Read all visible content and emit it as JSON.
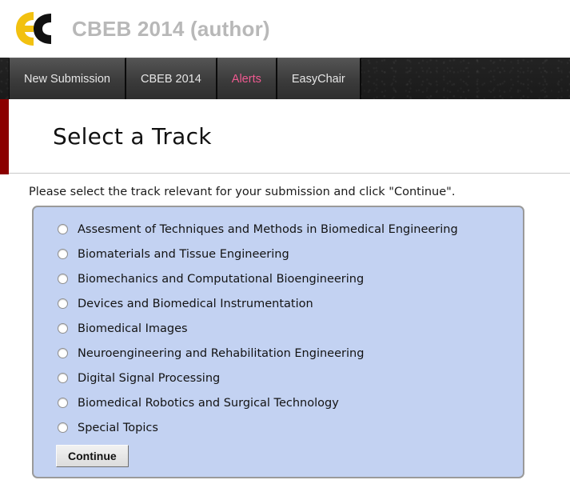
{
  "header": {
    "logo_icon": "easychair-ec-logo",
    "logo_colors": {
      "e": "#F2C110",
      "c": "#111111"
    },
    "title": "CBEB 2014 (author)",
    "title_color": "#b8b8b8"
  },
  "navbar": {
    "background_color": "#1e1e1e",
    "tabs": [
      {
        "label": "New Submission",
        "color": "#e6e6e6",
        "active": false
      },
      {
        "label": "CBEB 2014",
        "color": "#e6e6e6",
        "active": false
      },
      {
        "label": "Alerts",
        "color": "#f05a91",
        "active": false
      },
      {
        "label": "EasyChair",
        "color": "#e6e6e6",
        "active": false
      }
    ]
  },
  "page": {
    "accent_bar_color": "#8b0000",
    "title": "Select a Track",
    "instructions": "Please select the track relevant for your submission and click \"Continue\"."
  },
  "track_panel": {
    "background_color": "#c3d2f2",
    "border_color": "#9a9a9a",
    "selected": null,
    "tracks": [
      {
        "label": "Assesment of Techniques and Methods in Biomedical Engineering",
        "checked": false
      },
      {
        "label": "Biomaterials and Tissue Engineering",
        "checked": false
      },
      {
        "label": "Biomechanics and Computational Bioengineering",
        "checked": false
      },
      {
        "label": "Devices and Biomedical Instrumentation",
        "checked": false
      },
      {
        "label": "Biomedical Images",
        "checked": false
      },
      {
        "label": "Neuroengineering and Rehabilitation Engineering",
        "checked": false
      },
      {
        "label": "Digital Signal Processing",
        "checked": false
      },
      {
        "label": "Biomedical Robotics and Surgical Technology",
        "checked": false
      },
      {
        "label": "Special Topics",
        "checked": false
      }
    ],
    "continue_label": "Continue"
  }
}
